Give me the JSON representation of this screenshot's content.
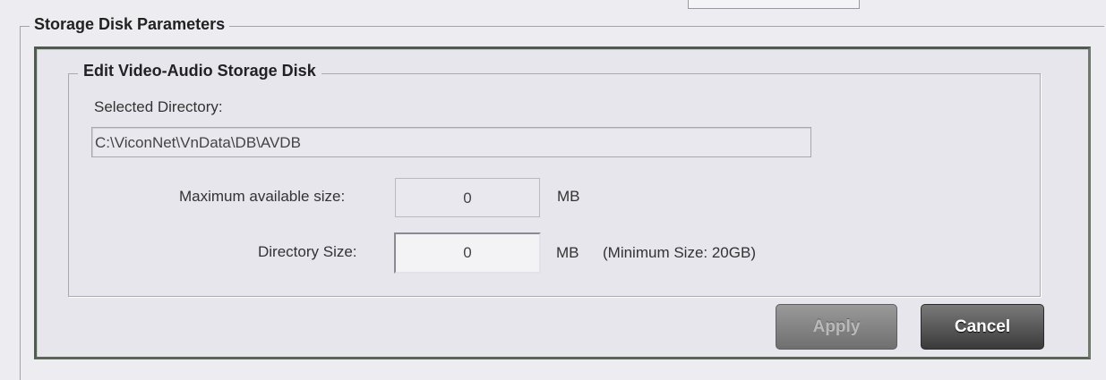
{
  "outer_group": {
    "legend": "Storage Disk Parameters"
  },
  "inner_group": {
    "legend": "Edit Video-Audio Storage Disk"
  },
  "selected_directory": {
    "label": "Selected Directory:",
    "value": "C:\\ViconNet\\VnData\\DB\\AVDB"
  },
  "max_size": {
    "label": "Maximum available size:",
    "value": "0",
    "unit": "MB"
  },
  "directory_size": {
    "label": "Directory Size:",
    "value": "0",
    "unit": "MB",
    "note": "(Minimum Size: 20GB)"
  },
  "buttons": {
    "apply": "Apply",
    "cancel": "Cancel"
  },
  "colors": {
    "panel_border": "#4e5b4e",
    "apply_disabled": "#7f7f7f",
    "cancel": "#4a4a4a"
  }
}
